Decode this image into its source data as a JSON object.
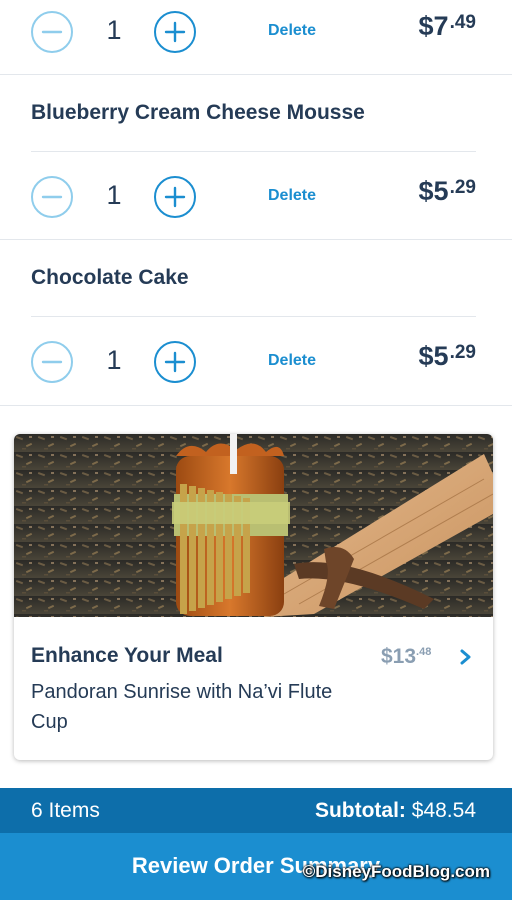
{
  "cart": {
    "items": [
      {
        "name": "",
        "qty": "1",
        "delete_label": "Delete",
        "price_dollars": "$7",
        "price_cents": ".49"
      },
      {
        "name": "Blueberry Cream Cheese Mousse",
        "qty": "1",
        "delete_label": "Delete",
        "price_dollars": "$5",
        "price_cents": ".29"
      },
      {
        "name": "Chocolate Cake",
        "qty": "1",
        "delete_label": "Delete",
        "price_dollars": "$5",
        "price_cents": ".29"
      }
    ]
  },
  "enhance": {
    "title": "Enhance Your Meal",
    "description": "Pandoran Sunrise with Na’vi Flute Cup",
    "price_dollars": "$13",
    "price_cents": ".48",
    "photo_icon": "pandoran-sunrise-flute-cup-photo",
    "chevron_icon": "chevron-right-icon"
  },
  "summary": {
    "items_count": "6 Items",
    "subtotal_label": "Subtotal:",
    "subtotal_value": "$48.54"
  },
  "review_button": {
    "label": "Review Order Summary"
  },
  "watermark": "©DisneyFoodBlog.com",
  "colors": {
    "text": "#253b56",
    "accent": "#1b8ed0",
    "summary_bar": "#0d6eaa",
    "minus_border": "#8fcdec",
    "muted_price": "#8a9eb2"
  }
}
